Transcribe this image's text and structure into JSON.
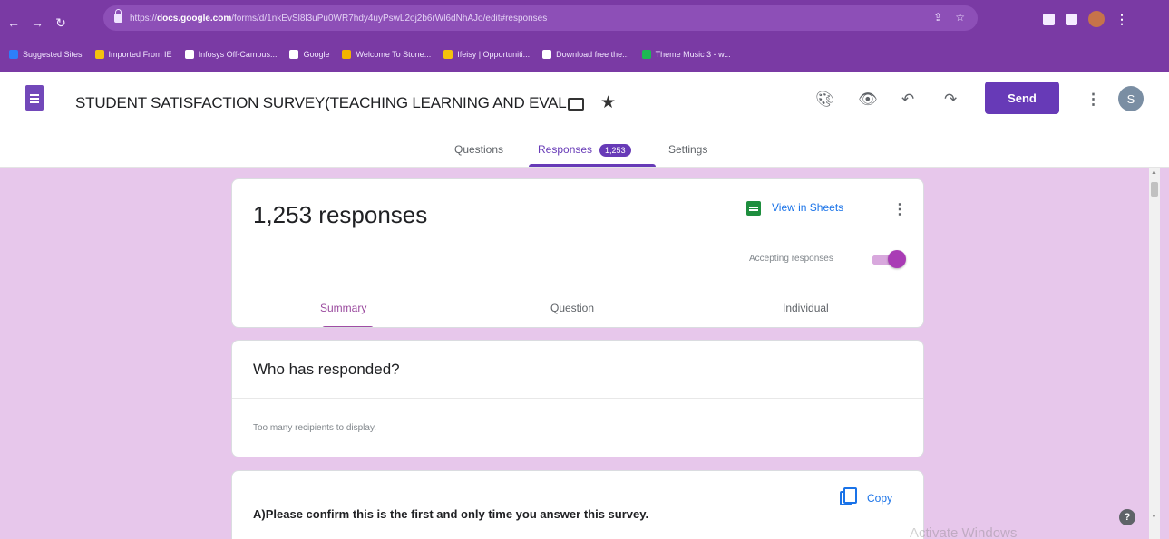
{
  "browser": {
    "url_prefix": "https://",
    "url_host": "docs.google.com",
    "url_rest": "/forms/d/1nkEvSl8l3uPu0WR7hdy4uyPswL2oj2b6rWl6dNhAJo/edit#responses",
    "bookmarks": [
      {
        "label": "Suggested Sites",
        "color": "#2d7ff9"
      },
      {
        "label": "Imported From IE",
        "color": "#f4c20d"
      },
      {
        "label": "Infosys Off-Campus...",
        "color": "#ffffff"
      },
      {
        "label": "Google",
        "color": "#ffffff"
      },
      {
        "label": "Welcome To Stone...",
        "color": "#f4b400"
      },
      {
        "label": "Ifeisy | Opportuniti...",
        "color": "#f4c20d"
      },
      {
        "label": "Download free the...",
        "color": "#ffffff"
      },
      {
        "label": "Theme Music 3 - w...",
        "color": "#1db954"
      }
    ]
  },
  "header": {
    "title": "STUDENT SATISFACTION SURVEY(TEACHING LEARNING AND EVAL",
    "send_label": "Send",
    "avatar_letter": "S",
    "accent": "#673ab7"
  },
  "tabs": {
    "questions": "Questions",
    "responses": "Responses",
    "responses_count": "1,253",
    "settings": "Settings"
  },
  "summary_card": {
    "responses_title": "1,253 responses",
    "view_in_sheets": "View in Sheets",
    "accepting_label": "Accepting responses",
    "accepting_on": true,
    "sub_tabs": [
      "Summary",
      "Question",
      "Individual"
    ]
  },
  "who_card": {
    "title": "Who has responded?",
    "note": "Too many recipients to display."
  },
  "question_card": {
    "question": "A)Please confirm this is the first and  only time you answer  this survey.",
    "copy_label": "Copy"
  },
  "watermark": "Activate Windows",
  "content_bg": "#e7c7eb"
}
